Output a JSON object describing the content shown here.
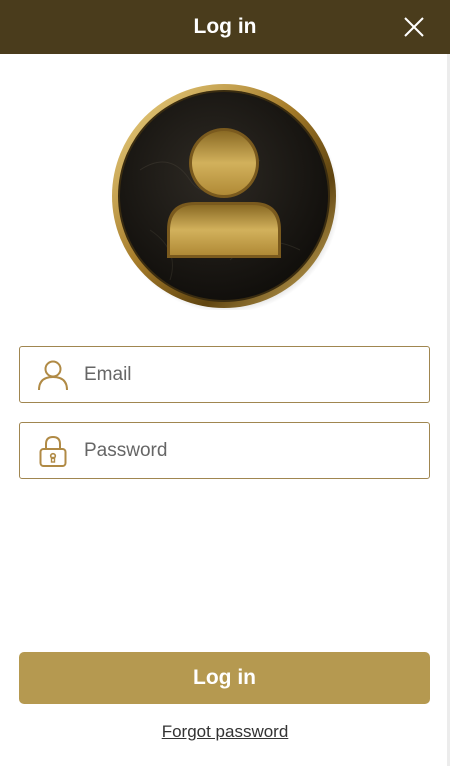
{
  "header": {
    "title": "Log in",
    "close_icon": "close-icon"
  },
  "avatar": {
    "icon": "user-avatar-icon"
  },
  "form": {
    "email": {
      "placeholder": "Email",
      "value": "",
      "icon": "user-icon"
    },
    "password": {
      "placeholder": "Password",
      "value": "",
      "icon": "lock-icon"
    }
  },
  "actions": {
    "login_label": "Log in",
    "forgot_label": "Forgot password"
  },
  "colors": {
    "header_bg": "#4a3c1c",
    "accent_gold": "#b59950",
    "field_border": "#a08650"
  }
}
